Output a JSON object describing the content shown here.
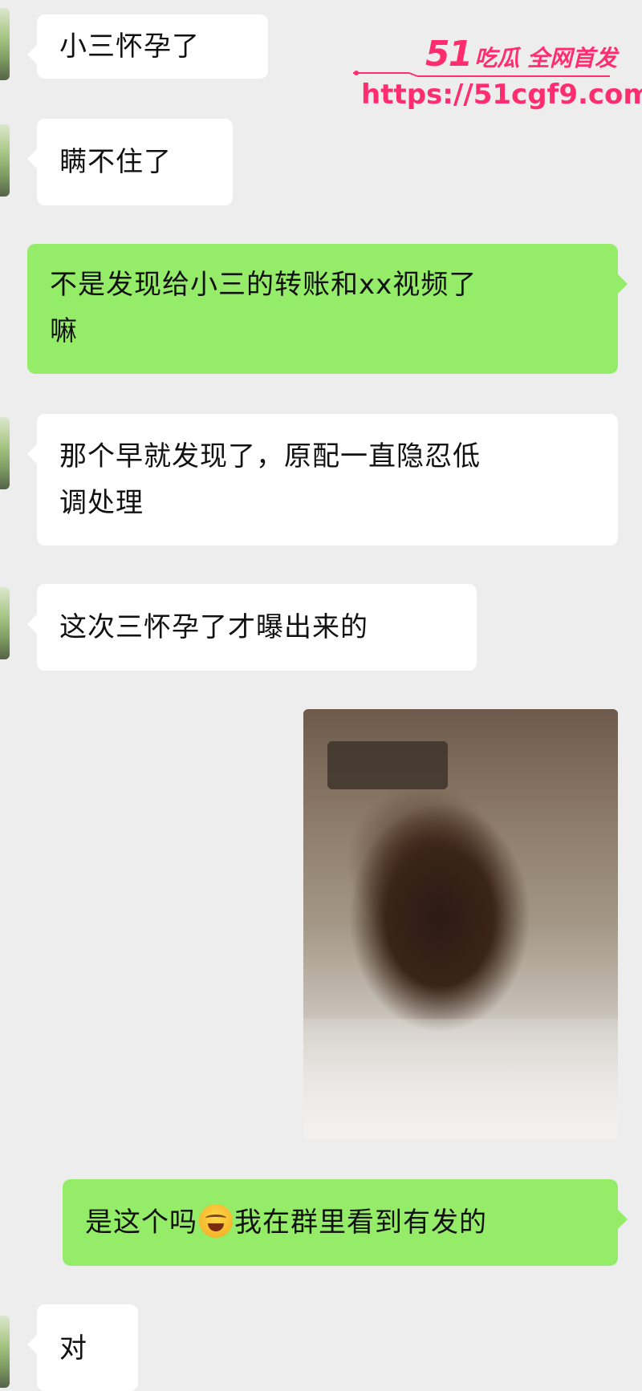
{
  "messages": [
    {
      "side": "left",
      "text": "小三怀孕了"
    },
    {
      "side": "left",
      "text": "瞒不住了"
    },
    {
      "side": "right",
      "text_line1": "不是发现给小三的转账和xx视频了",
      "text_line2": "嘛"
    },
    {
      "side": "left",
      "text_line1": "那个早就发现了，原配一直隐忍低",
      "text_line2": "调处理"
    },
    {
      "side": "left",
      "text": "这次三怀孕了才曝出来的"
    },
    {
      "side": "right",
      "type": "image"
    },
    {
      "side": "right",
      "text_before_emoji": "是这个吗",
      "emoji": "crying-face",
      "text_after_emoji": "我在群里看到有发的"
    },
    {
      "side": "left",
      "text": "对"
    }
  ],
  "watermark": {
    "brand_number": "51",
    "brand_text": "吃瓜 全网首发",
    "url": "https://51cgf9.com"
  },
  "colors": {
    "background": "#ededed",
    "left_bubble": "#ffffff",
    "right_bubble": "#95ec69",
    "watermark": "#ff2d6f"
  }
}
